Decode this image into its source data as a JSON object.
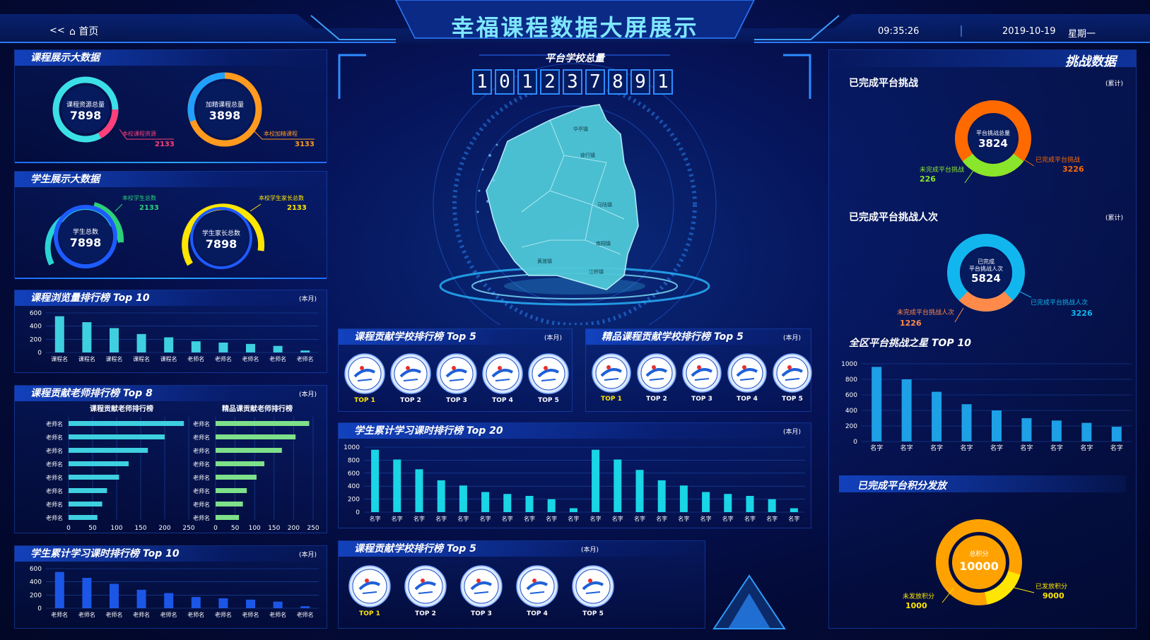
{
  "header": {
    "back": "<<",
    "home": "首页",
    "title": "幸福课程数据大屏展示",
    "time": "09:35:26",
    "date": "2019-10-19",
    "weekday": "星期一"
  },
  "course_big_data": {
    "title": "课程展示大数据",
    "ring1": {
      "label": "课程资源总量",
      "value": "7898",
      "sub_label": "本校课程资源",
      "sub_value": "2133"
    },
    "ring2": {
      "label": "加精课程总量",
      "value": "3898",
      "sub_label": "本校加精课程",
      "sub_value": "3133"
    }
  },
  "student_big_data": {
    "title": "学生展示大数据",
    "ring1": {
      "label": "学生总数",
      "value": "7898",
      "sub_label": "本校学生总数",
      "sub_value": "2133"
    },
    "ring2": {
      "label": "学生家长总数",
      "value": "7898",
      "sub_label": "本校学生家长总数",
      "sub_value": "2133"
    }
  },
  "course_views": {
    "title": "课程浏览量排行榜 Top 10",
    "note": "(本月)",
    "chart_data": {
      "type": "bar",
      "categories": [
        "课程名",
        "课程名",
        "课程名",
        "课程名",
        "课程名",
        "老师名",
        "老师名",
        "老师名",
        "老师名",
        "老师名"
      ],
      "values": [
        550,
        460,
        370,
        280,
        230,
        170,
        150,
        130,
        100,
        30
      ],
      "ylim": [
        0,
        600
      ],
      "yticks": [
        "0",
        "200",
        "400",
        "600"
      ]
    }
  },
  "teacher_rank": {
    "title": "课程贡献老师排行榜 Top 8",
    "note": "(本月)",
    "left": {
      "subtitle": "课程贡献老师排行榜",
      "categories": [
        "老师名",
        "老师名",
        "老师名",
        "老师名",
        "老师名",
        "老师名",
        "老师名",
        "老师名"
      ],
      "values": [
        240,
        200,
        165,
        125,
        105,
        80,
        70,
        60
      ]
    },
    "right": {
      "subtitle": "精品课贡献老师排行榜",
      "categories": [
        "老师名",
        "老师名",
        "老师名",
        "老师名",
        "老师名",
        "老师名",
        "老师名",
        "老师名"
      ],
      "values": [
        240,
        205,
        170,
        125,
        105,
        80,
        70,
        60
      ]
    },
    "xticks": [
      "0",
      "50",
      "100",
      "150",
      "200",
      "250"
    ]
  },
  "student_hours_left": {
    "title": "学生累计学习课时排行榜 Top 10",
    "note": "(本月)",
    "chart_data": {
      "type": "bar",
      "categories": [
        "老师名",
        "老师名",
        "老师名",
        "老师名",
        "老师名",
        "老师名",
        "老师名",
        "老师名",
        "老师名",
        "老师名"
      ],
      "values": [
        550,
        460,
        370,
        280,
        230,
        170,
        150,
        130,
        100,
        30
      ],
      "ylim": [
        0,
        600
      ],
      "yticks": [
        "0",
        "200",
        "400",
        "600"
      ]
    }
  },
  "platform": {
    "title": "平台学校总量",
    "digits": [
      "1",
      "0",
      "1",
      "2",
      "3",
      "7",
      "8",
      "9",
      "1"
    ]
  },
  "map_labels": [
    "华亭镇",
    "徐行镇",
    "马陆镇",
    "南翔镇",
    "黄渡镇",
    "江桥镇"
  ],
  "school_rank_a": {
    "title": "课程贡献学校排行榜 Top 5",
    "note": "(本月)",
    "labels": [
      "TOP 1",
      "TOP 2",
      "TOP 3",
      "TOP 4",
      "TOP 5"
    ]
  },
  "school_rank_b": {
    "title": "精品课程贡献学校排行榜 Top 5",
    "note": "(本月)",
    "labels": [
      "TOP 1",
      "TOP 2",
      "TOP 3",
      "TOP 4",
      "TOP 5"
    ]
  },
  "student_hours_mid": {
    "title": "学生累计学习课时排行榜 Top 20",
    "note": "(本月)",
    "chart_data": {
      "type": "bar",
      "categories": [
        "名字",
        "名字",
        "名字",
        "名字",
        "名字",
        "名字",
        "名字",
        "名字",
        "名字",
        "名字",
        "名字",
        "名字",
        "名字",
        "名字",
        "名字",
        "名字",
        "名字",
        "名字",
        "名字",
        "名字"
      ],
      "values": [
        960,
        810,
        660,
        490,
        410,
        310,
        280,
        250,
        200,
        60,
        960,
        810,
        650,
        490,
        410,
        310,
        280,
        250,
        200,
        60
      ],
      "ylim": [
        0,
        1000
      ],
      "yticks": [
        "0",
        "200",
        "400",
        "600",
        "800",
        "1000"
      ]
    }
  },
  "school_rank_c": {
    "title": "课程贡献学校排行榜 Top 5",
    "note": "(本月)",
    "labels": [
      "TOP 1",
      "TOP 2",
      "TOP 3",
      "TOP 4",
      "TOP 5"
    ]
  },
  "challenge": {
    "title": "挑战数据",
    "completed": {
      "title": "已完成平台挑战",
      "note": "(累计)",
      "center_label": "平台挑战总量",
      "center_value": "3824",
      "left_label": "未完成平台挑战",
      "left_value": "226",
      "right_label": "已完成平台挑战",
      "right_value": "3226",
      "chart_data": {
        "type": "pie",
        "values": [
          3226,
          226
        ],
        "labels": [
          "已完成平台挑战",
          "未完成平台挑战"
        ]
      }
    },
    "people": {
      "title": "已完成平台挑战人次",
      "note": "(累计)",
      "center_label1": "已完成",
      "center_label2": "平台挑战人次",
      "center_value": "5824",
      "left_label": "未完成平台挑战人次",
      "left_value": "1226",
      "right_label": "已完成平台挑战人次",
      "right_value": "3226",
      "chart_data": {
        "type": "pie",
        "values": [
          3226,
          1226
        ],
        "labels": [
          "已完成平台挑战人次",
          "未完成平台挑战人次"
        ]
      }
    },
    "stars": {
      "title": "全区平台挑战之星 TOP 10",
      "chart_data": {
        "type": "bar",
        "categories": [
          "名字",
          "名字",
          "名字",
          "名字",
          "名字",
          "名字",
          "名字",
          "名字",
          "名字"
        ],
        "values": [
          960,
          800,
          640,
          480,
          400,
          300,
          270,
          240,
          190
        ],
        "ylim": [
          0,
          1000
        ],
        "yticks": [
          "0",
          "200",
          "400",
          "600",
          "800",
          "1000"
        ]
      }
    },
    "points": {
      "title": "已完成平台积分发放",
      "center_label": "总积分",
      "center_value": "10000",
      "left_label": "未发放积分",
      "left_value": "1000",
      "right_label": "已发放积分",
      "right_value": "9000",
      "chart_data": {
        "type": "pie",
        "values": [
          9000,
          1000
        ],
        "labels": [
          "已发放积分",
          "未发放积分"
        ]
      }
    }
  },
  "colors": {
    "cyan": "#38d6ff",
    "yellow": "#ffe600",
    "orange": "#ff9a1f",
    "pink": "#ff3f7a"
  }
}
